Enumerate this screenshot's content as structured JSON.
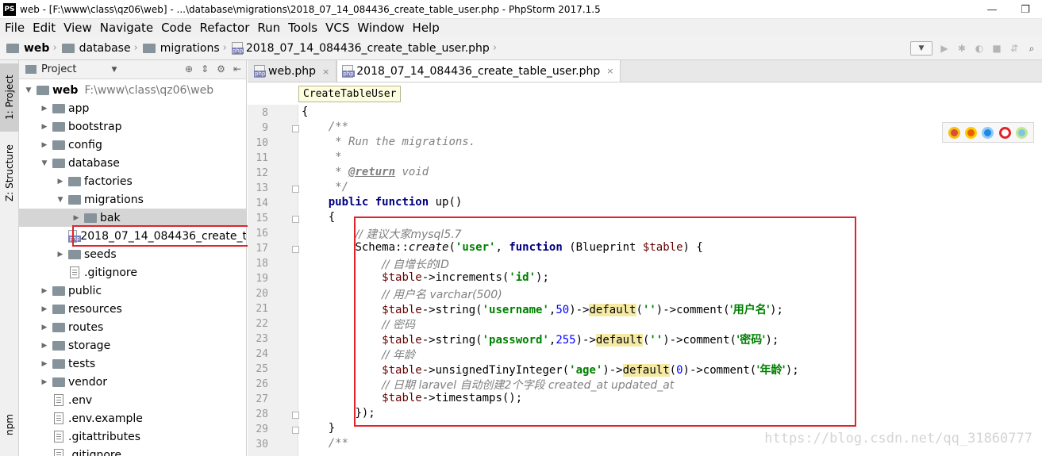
{
  "window": {
    "app_icon": "PS",
    "title": "web - [F:\\www\\class\\qz06\\web] - ...\\database\\migrations\\2018_07_14_084436_create_table_user.php - PhpStorm 2017.1.5",
    "minimize": "—",
    "maximize": "❐"
  },
  "menu": [
    "File",
    "Edit",
    "View",
    "Navigate",
    "Code",
    "Refactor",
    "Run",
    "Tools",
    "VCS",
    "Window",
    "Help"
  ],
  "breadcrumbs": [
    "web",
    "database",
    "migrations",
    "2018_07_14_084436_create_table_user.php"
  ],
  "left_strip": {
    "project_tab": "1: Project",
    "structure_tab": "Z: Structure",
    "npm_tab": "npm"
  },
  "project_panel": {
    "title": "Project",
    "tree": [
      {
        "label": "web",
        "path": "F:\\www\\class\\qz06\\web",
        "depth": 0,
        "type": "folder",
        "open": true
      },
      {
        "label": "app",
        "depth": 1,
        "type": "folder",
        "open": false
      },
      {
        "label": "bootstrap",
        "depth": 1,
        "type": "folder",
        "open": false
      },
      {
        "label": "config",
        "depth": 1,
        "type": "folder",
        "open": false
      },
      {
        "label": "database",
        "depth": 1,
        "type": "folder",
        "open": true
      },
      {
        "label": "factories",
        "depth": 2,
        "type": "folder",
        "open": false
      },
      {
        "label": "migrations",
        "depth": 2,
        "type": "folder",
        "open": true
      },
      {
        "label": "bak",
        "depth": 3,
        "type": "folder",
        "open": false,
        "selected": true
      },
      {
        "label": "2018_07_14_084436_create_t",
        "depth": 3,
        "type": "php"
      },
      {
        "label": "seeds",
        "depth": 2,
        "type": "folder",
        "open": false
      },
      {
        "label": ".gitignore",
        "depth": 2,
        "type": "file"
      },
      {
        "label": "public",
        "depth": 1,
        "type": "folder",
        "open": false
      },
      {
        "label": "resources",
        "depth": 1,
        "type": "folder",
        "open": false
      },
      {
        "label": "routes",
        "depth": 1,
        "type": "folder",
        "open": false
      },
      {
        "label": "storage",
        "depth": 1,
        "type": "folder",
        "open": false
      },
      {
        "label": "tests",
        "depth": 1,
        "type": "folder",
        "open": false
      },
      {
        "label": "vendor",
        "depth": 1,
        "type": "folder",
        "open": false
      },
      {
        "label": ".env",
        "depth": 1,
        "type": "file"
      },
      {
        "label": ".env.example",
        "depth": 1,
        "type": "file"
      },
      {
        "label": ".gitattributes",
        "depth": 1,
        "type": "file"
      },
      {
        "label": ".gitignore",
        "depth": 1,
        "type": "file"
      }
    ]
  },
  "editor": {
    "tabs": [
      {
        "label": "web.php",
        "active": false
      },
      {
        "label": "2018_07_14_084436_create_table_user.php",
        "active": true
      }
    ],
    "tab_close": "×",
    "class_hint": "CreateTableUser",
    "line_numbers": [
      "8",
      "9",
      "10",
      "11",
      "12",
      "13",
      "14",
      "15",
      "16",
      "17",
      "18",
      "19",
      "20",
      "21",
      "22",
      "23",
      "24",
      "25",
      "26",
      "27",
      "28",
      "29",
      "30"
    ],
    "code": {
      "l8": "{",
      "l9": "/**",
      "l10": "* Run the migrations.",
      "l11": "*",
      "l12_tag": "@return",
      "l12_type": " void",
      "l13": "*/",
      "l14_kw1": "public",
      "l14_kw2": "function",
      "l14_rest": " up()",
      "l15": "{",
      "l16": "// 建议大家mysql5.7",
      "l17_a": "Schema::",
      "l17_b": "create",
      "l17_c": "(",
      "l17_str": "'user'",
      "l17_d": ", ",
      "l17_kw": "function",
      "l17_e": " (Blueprint ",
      "l17_var": "$table",
      "l17_f": ") {",
      "l18": "// 自增长的ID",
      "l19_var": "$table",
      "l19_a": "->increments(",
      "l19_str": "'id'",
      "l19_b": ");",
      "l20": "// 用户名 varchar(500)",
      "l21_var": "$table",
      "l21_a": "->string(",
      "l21_str1": "'username'",
      "l21_b": ",",
      "l21_num": "50",
      "l21_c": ")->",
      "l21_hl": "default",
      "l21_d": "(",
      "l21_str2": "''",
      "l21_e": ")->comment(",
      "l21_str3": "'用户名'",
      "l21_f": ");",
      "l22": "// 密码",
      "l23_var": "$table",
      "l23_a": "->string(",
      "l23_str1": "'password'",
      "l23_b": ",",
      "l23_num": "255",
      "l23_c": ")->",
      "l23_hl": "default",
      "l23_d": "(",
      "l23_str2": "''",
      "l23_e": ")->comment(",
      "l23_str3": "'密码'",
      "l23_f": ");",
      "l24": "// 年龄",
      "l25_var": "$table",
      "l25_a": "->unsignedTinyInteger(",
      "l25_str1": "'age'",
      "l25_c": ")->",
      "l25_hl": "default",
      "l25_d": "(",
      "l25_num": "0",
      "l25_e": ")->comment(",
      "l25_str3": "'年龄'",
      "l25_f": ");",
      "l26": "// 日期 laravel 自动创建2个字段 created_at updated_at",
      "l27_var": "$table",
      "l27_a": "->timestamps();",
      "l28": "});",
      "l29": "}",
      "l30": "/**"
    }
  },
  "watermark": "https://blog.csdn.net/qq_31860777",
  "colors": {
    "highlight_box": "#e0242b",
    "keyword": "#000080",
    "string": "#008000",
    "comment": "#808080"
  }
}
